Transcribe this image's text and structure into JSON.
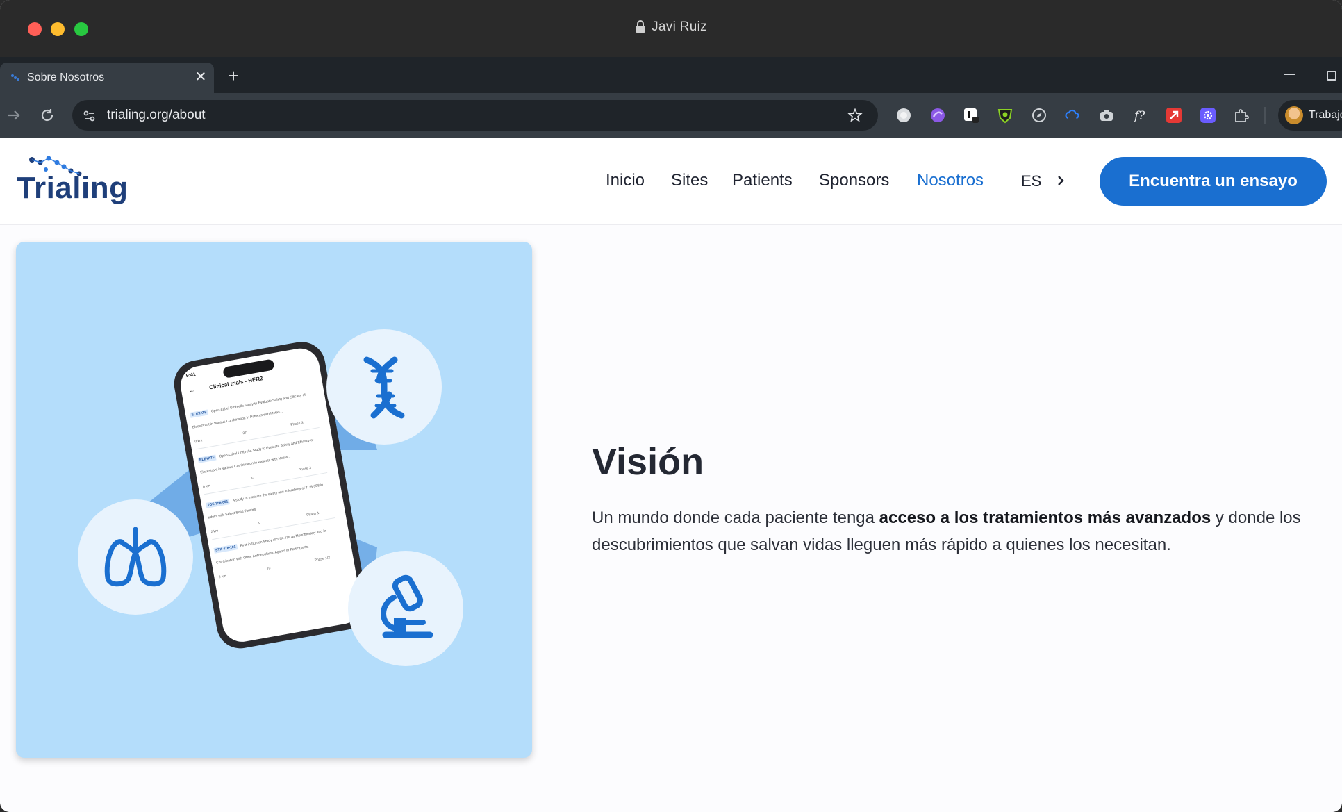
{
  "os_window": {
    "title": "Javi Ruiz"
  },
  "browser": {
    "tab": {
      "title": "Sobre Nosotros"
    },
    "url": "trialing.org/about",
    "profile_label": "Trabajo"
  },
  "site": {
    "logo_text": "Trialing",
    "nav": [
      "Inicio",
      "Sites",
      "Patients",
      "Sponsors",
      "Nosotros"
    ],
    "active_nav": "Nosotros",
    "language": "ES",
    "cta_label": "Encuentra un ensayo",
    "accent_color": "#1a6fd0"
  },
  "hero": {
    "phone": {
      "time": "9:41",
      "header": "Clinical trials - HER2",
      "cards": [
        {
          "tag": "ELEVATE",
          "text": "Open-Label Umbrella Study to Evaluate Safety and Efficacy of Elacestrant in Various Combination in Patients with Metas...",
          "distance": "0 km",
          "count": "37",
          "phase": "Phase 3"
        },
        {
          "tag": "ELEVATE",
          "text": "Open-Label Umbrella Study to Evaluate Safety and Efficacy of Elacestrant in Various Combination in Patients with Metas...",
          "distance": "0 km",
          "count": "37",
          "phase": "Phase 3"
        },
        {
          "tag": "TOS-358-001",
          "text": "A study to evaluate the safety and Tolerability of TOS-358 in adults with Select Solid Tumors",
          "distance": "2 km",
          "count": "9",
          "phase": "Phase 1"
        },
        {
          "tag": "STX-478-101",
          "text": "First-in-human Study of STX-478 as Monotherapy and in Combination with Other Antineoplastic Agents in Participants...",
          "distance": "2 km",
          "count": "70",
          "phase": "Phase 1/2"
        }
      ]
    }
  },
  "vision": {
    "title": "Visión",
    "body_pre": "Un mundo donde cada paciente tenga ",
    "body_bold": "acceso a los tratamientos más avanzados",
    "body_post": " y donde los descubrimientos que salvan vidas lleguen más rápido a quienes los necesitan."
  },
  "icons": {
    "dna": "dna-icon",
    "lungs": "lungs-icon",
    "microscope": "microscope-icon"
  }
}
